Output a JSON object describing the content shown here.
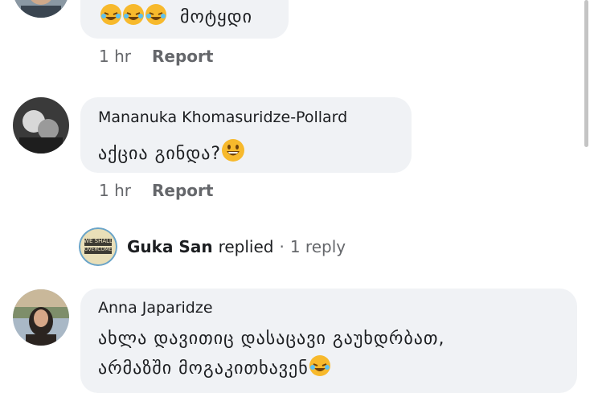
{
  "comments": [
    {
      "author": "",
      "text": "მოტყდი",
      "emoji": [
        "rolling-laughing-emoji",
        "rolling-laughing-emoji",
        "rolling-laughing-emoji"
      ],
      "time": "1 hr",
      "report": "Report"
    },
    {
      "author": "Mananuka Khomasuridze-Pollard",
      "text": "აქცია გინდა?",
      "emoji": [
        "grinning-emoji"
      ],
      "time": "1 hr",
      "report": "Report"
    },
    {
      "author": "Anna Japaridze",
      "text_line1": "ახლა დავითიც დასაცავი გაუხდრბათ,",
      "text_line2": "არმაზში მოგაკითხავენ",
      "emoji": [
        "rolling-laughing-emoji"
      ]
    }
  ],
  "reply": {
    "avatar_text_top": "WE SHALL",
    "avatar_text_bottom": "OVERCOME",
    "name": "Guka San",
    "action": "replied",
    "separator": "·",
    "count": "1 reply"
  },
  "colors": {
    "bubble": "#f0f2f5",
    "meta": "#65676b",
    "text": "#1c1e21",
    "emoji_yellow": "#f7b92c"
  }
}
